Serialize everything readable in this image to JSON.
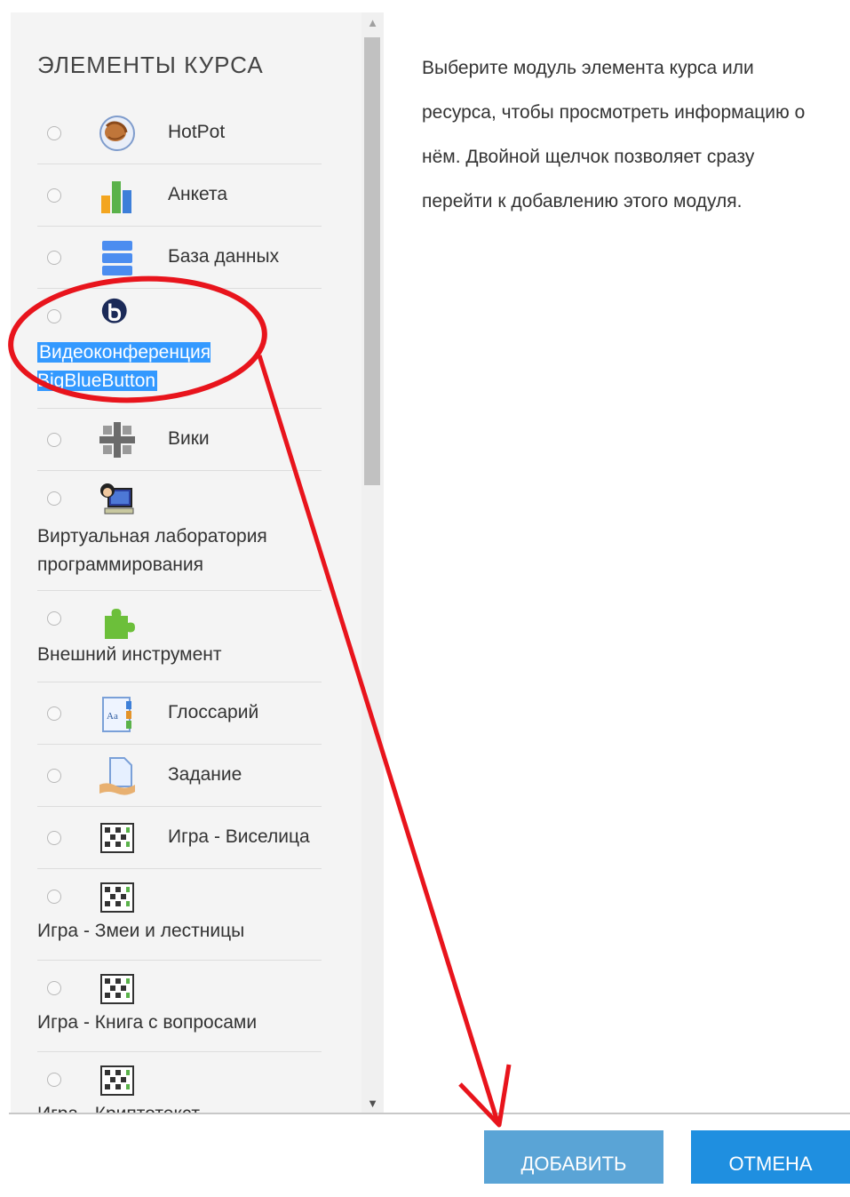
{
  "header": {
    "section_title": "ЭЛЕМЕНТЫ КУРСА"
  },
  "items": [
    {
      "label": "HotPot",
      "icon": "hotpot-icon"
    },
    {
      "label": "Анкета",
      "icon": "bar-chart-icon"
    },
    {
      "label": "База данных",
      "icon": "database-icon"
    },
    {
      "label": "Видеоконференция BigBlueButton",
      "icon": "bigbluebutton-icon",
      "selected": true
    },
    {
      "label": "Вики",
      "icon": "wiki-icon"
    },
    {
      "label": "Виртуальная лаборатория программирования",
      "icon": "vpl-icon"
    },
    {
      "label": "Внешний инструмент",
      "icon": "puzzle-icon"
    },
    {
      "label": "Глоссарий",
      "icon": "glossary-icon"
    },
    {
      "label": "Задание",
      "icon": "assignment-icon"
    },
    {
      "label": "Игра - Виселица",
      "icon": "game-grid-icon"
    },
    {
      "label": "Игра - Змеи и лестницы",
      "icon": "game-grid-icon"
    },
    {
      "label": "Игра - Книга с вопросами",
      "icon": "game-grid-icon"
    },
    {
      "label": "Игра - Криптотекст",
      "icon": "game-grid-icon"
    }
  ],
  "help": {
    "text": "Выберите модуль элемента курса или ресурса, чтобы просмотреть информацию о нём. Двойной щелчок позволяет сразу перейти к добавлению этого модуля."
  },
  "footer": {
    "add_label": "ДОБАВИТЬ",
    "cancel_label": "ОТМЕНА"
  },
  "colors": {
    "accent": "#1f8fe0",
    "selection": "#3399ff",
    "annotation": "#e8141c"
  }
}
